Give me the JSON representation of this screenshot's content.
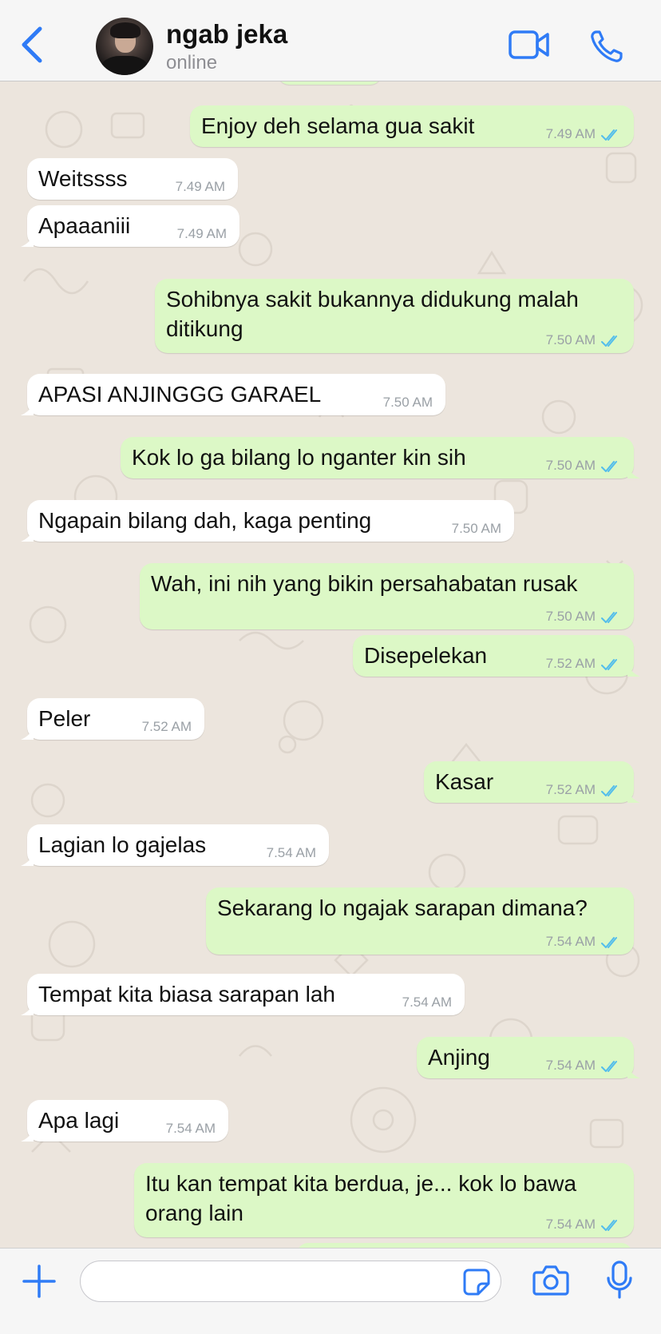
{
  "header": {
    "contact_name": "ngab jeka",
    "status": "online",
    "accent_color": "#2f7bf6"
  },
  "messages": [
    {
      "dir": "out",
      "text": "Enjoy deh selama gua sakit",
      "time": "7.49 AM"
    },
    {
      "dir": "in",
      "text": "Weitssss",
      "time": "7.49 AM"
    },
    {
      "dir": "in",
      "text": "Apaaaniii",
      "time": "7.49 AM"
    },
    {
      "dir": "out",
      "text": "Sohibnya sakit bukannya didukung malah",
      "text2": "ditikung",
      "time": "7.50 AM"
    },
    {
      "dir": "in",
      "text": "APASI ANJINGGG GARAEL",
      "time": "7.50 AM"
    },
    {
      "dir": "out",
      "text": "Kok lo ga bilang lo nganter kin sih",
      "time": "7.50 AM"
    },
    {
      "dir": "in",
      "text": "Ngapain bilang dah, kaga penting",
      "time": "7.50 AM"
    },
    {
      "dir": "out",
      "text": "Wah, ini nih yang bikin persahabatan rusak",
      "time": "7.50 AM"
    },
    {
      "dir": "out",
      "text": "Disepelekan",
      "time": "7.52 AM"
    },
    {
      "dir": "in",
      "text": "Peler",
      "time": "7.52 AM"
    },
    {
      "dir": "out",
      "text": "Kasar",
      "time": "7.52 AM"
    },
    {
      "dir": "in",
      "text": "Lagian lo gajelas",
      "time": "7.54 AM"
    },
    {
      "dir": "out",
      "text": "Sekarang lo ngajak sarapan dimana?",
      "time": "7.54 AM"
    },
    {
      "dir": "in",
      "text": "Tempat kita biasa sarapan lah",
      "time": "7.54 AM"
    },
    {
      "dir": "out",
      "text": "Anjing",
      "time": "7.54 AM"
    },
    {
      "dir": "in",
      "text": "Apa lagi",
      "time": "7.54 AM"
    },
    {
      "dir": "out",
      "text": "Itu kan tempat kita berdua, je... kok lo bawa",
      "text2": "orang lain",
      "time": "7.54 AM"
    }
  ],
  "composer": {
    "value": "",
    "placeholder": ""
  },
  "icons": {
    "back": "chevron-left-icon",
    "video": "video-call-icon",
    "call": "phone-icon",
    "plus": "plus-icon",
    "sticker": "sticker-icon",
    "camera": "camera-icon",
    "mic": "microphone-icon",
    "read_receipt": "double-check-icon"
  },
  "colors": {
    "incoming_bubble": "#ffffff",
    "outgoing_bubble": "#dcf8c6",
    "chat_background": "#ece5dd",
    "read_ticks": "#53bdeb"
  }
}
